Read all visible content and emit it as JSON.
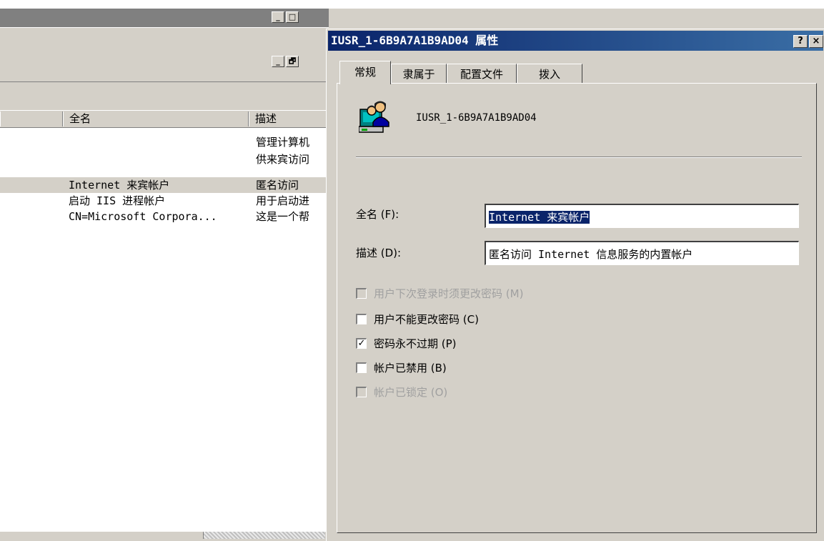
{
  "background_window": {
    "title_buttons": [
      "_",
      "□",
      "×"
    ],
    "mdi_buttons": [
      "_",
      "🗗",
      "×"
    ],
    "list": {
      "columns": [
        "全名",
        "描述"
      ],
      "rows": [
        {
          "full_name": "",
          "description": "管理计算机"
        },
        {
          "full_name": "",
          "description": "供来宾访问"
        },
        {
          "full_name": "Internet 来宾帐户",
          "description": "匿名访问",
          "selected": true
        },
        {
          "full_name": "启动 IIS 进程帐户",
          "description": "用于启动进"
        },
        {
          "full_name": "CN=Microsoft Corpora...",
          "description": "这是一个帮"
        }
      ]
    }
  },
  "dialog": {
    "title": "IUSR_1-6B9A7A1B9AD04 属性",
    "help_button": "?",
    "close_button": "×",
    "tabs": [
      "常规",
      "隶属于",
      "配置文件",
      "拨入"
    ],
    "active_tab": "常规",
    "user_icon": "users-icon",
    "username": "IUSR_1-6B9A7A1B9AD04",
    "fields": {
      "full_name": {
        "label": "全名 (F):",
        "value": "Internet 来宾帐户"
      },
      "description": {
        "label": "描述 (D):",
        "value": "匿名访问 Internet 信息服务的内置帐户"
      }
    },
    "checkboxes": [
      {
        "label": "用户下次登录时须更改密码 (M)",
        "checked": false,
        "enabled": false
      },
      {
        "label": "用户不能更改密码 (C)",
        "checked": false,
        "enabled": true
      },
      {
        "label": "密码永不过期 (P)",
        "checked": true,
        "enabled": true
      },
      {
        "label": "帐户已禁用 (B)",
        "checked": false,
        "enabled": true
      },
      {
        "label": "帐户已锁定 (O)",
        "checked": false,
        "enabled": false
      }
    ]
  },
  "colors": {
    "face": "#d4d0c8",
    "title_active": "#0a246a",
    "title_inactive": "#808080",
    "selection": "#0a246a"
  }
}
